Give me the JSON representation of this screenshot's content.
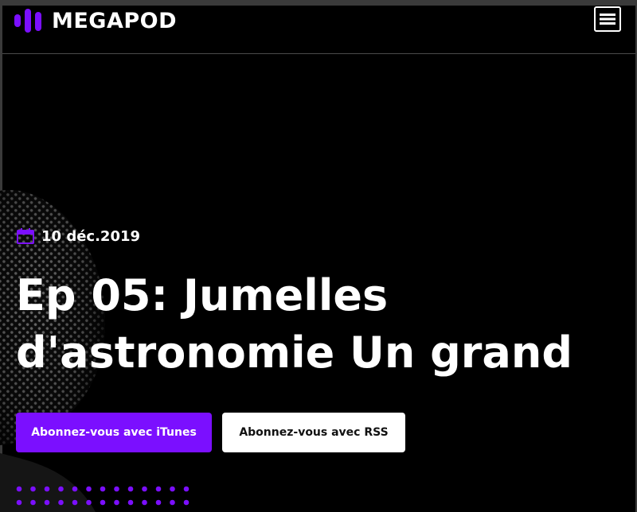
{
  "header": {
    "logo_text": "MEGAPOD",
    "menu_icon": "hamburger-menu-icon"
  },
  "episode": {
    "date": "10 déc.2019",
    "title": "Ep 05: Jumelles d'astronomie Un grand"
  },
  "buttons": {
    "itunes_label": "Abonnez-vous avec iTunes",
    "rss_label": "Abonnez-vous avec RSS"
  },
  "colors": {
    "accent": "#7b0fff",
    "background": "#000000",
    "text": "#ffffff"
  },
  "icons": [
    "logo-bars-icon",
    "hamburger-menu-icon",
    "calendar-icon",
    "dot-grid-decoration"
  ]
}
